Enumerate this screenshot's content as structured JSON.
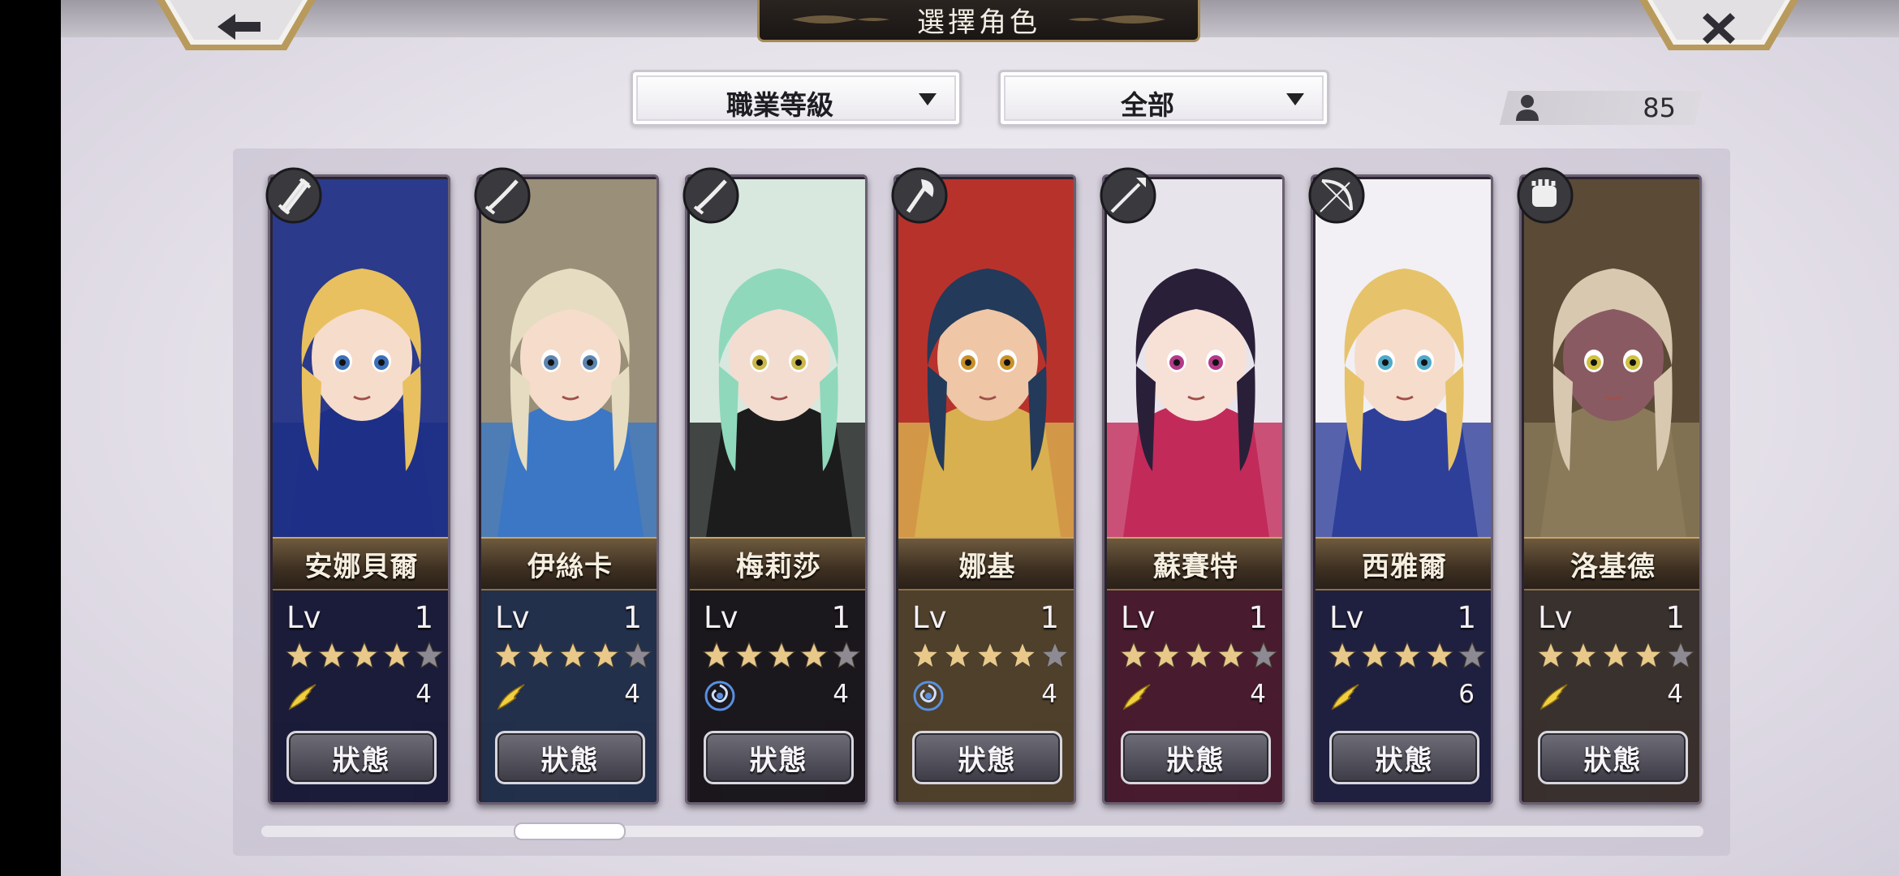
{
  "header": {
    "title": "選擇角色",
    "back_icon": "left-arrow-icon",
    "close_icon": "close-x-icon"
  },
  "filters": {
    "sort": {
      "label": "職業等級"
    },
    "category": {
      "label": "全部"
    }
  },
  "roster": {
    "count": "85",
    "icon": "person-icon"
  },
  "scroll": {
    "position": 0.19
  },
  "colors": {
    "accent_gold": "#c7a56a",
    "star_filled": "#e9c98a",
    "star_empty": "#8d8a94",
    "wing_gold": "#f0d040",
    "spiral_blue": "#5a8fe0"
  },
  "characters": [
    {
      "name": "安娜貝爾",
      "lv_label": "Lv",
      "level": "1",
      "stars": 4,
      "max_stars": 5,
      "attr_icon": "gold-wing-icon",
      "attr_value": "4",
      "weapon_icon": "sword-icon",
      "status_label": "狀態",
      "theme": "#2b3a8a",
      "hair": "#e8c060",
      "skin": "#f6dccb",
      "eye": "#3c6fb8",
      "accent": "#1d2f86"
    },
    {
      "name": "伊絲卡",
      "lv_label": "Lv",
      "level": "1",
      "stars": 4,
      "max_stars": 5,
      "attr_icon": "gold-wing-icon",
      "attr_value": "4",
      "weapon_icon": "katana-icon",
      "status_label": "狀態",
      "theme": "#9a8f78",
      "hair": "#e6dcc2",
      "skin": "#f5dccb",
      "eye": "#5d84b0",
      "accent": "#3b77c4"
    },
    {
      "name": "梅莉莎",
      "lv_label": "Lv",
      "level": "1",
      "stars": 4,
      "max_stars": 5,
      "attr_icon": "blue-spiral-icon",
      "attr_value": "4",
      "weapon_icon": "katana-icon",
      "status_label": "狀態",
      "theme": "#d8e8df",
      "hair": "#8fd8bc",
      "skin": "#f3ddd0",
      "eye": "#c9b84a",
      "accent": "#1c1c1c"
    },
    {
      "name": "娜基",
      "lv_label": "Lv",
      "level": "1",
      "stars": 4,
      "max_stars": 5,
      "attr_icon": "blue-spiral-icon",
      "attr_value": "4",
      "weapon_icon": "axe-icon",
      "status_label": "狀態",
      "theme": "#b8322c",
      "hair": "#233a5a",
      "skin": "#efc6a6",
      "eye": "#c8902a",
      "accent": "#d9b050"
    },
    {
      "name": "蘇賽特",
      "lv_label": "Lv",
      "level": "1",
      "stars": 4,
      "max_stars": 5,
      "attr_icon": "gold-wing-icon",
      "attr_value": "4",
      "weapon_icon": "spear-icon",
      "status_label": "狀態",
      "theme": "#e8e4ec",
      "hair": "#2a1f38",
      "skin": "#f7e0d6",
      "eye": "#b03a88",
      "accent": "#c22a5a"
    },
    {
      "name": "西雅爾",
      "lv_label": "Lv",
      "level": "1",
      "stars": 4,
      "max_stars": 5,
      "attr_icon": "gold-wing-icon",
      "attr_value": "6",
      "weapon_icon": "bow-icon",
      "status_label": "狀態",
      "theme": "#f2f0f4",
      "hair": "#e6c36a",
      "skin": "#f6dccb",
      "eye": "#4fa8c8",
      "accent": "#2e3f9a"
    },
    {
      "name": "洛基德",
      "lv_label": "Lv",
      "level": "1",
      "stars": 4,
      "max_stars": 5,
      "attr_icon": "gold-wing-icon",
      "attr_value": "4",
      "weapon_icon": "fist-icon",
      "status_label": "狀態",
      "theme": "#5a4a36",
      "hair": "#d8c8b0",
      "skin": "#8a5a62",
      "eye": "#d0c040",
      "accent": "#8a7a5a"
    }
  ]
}
